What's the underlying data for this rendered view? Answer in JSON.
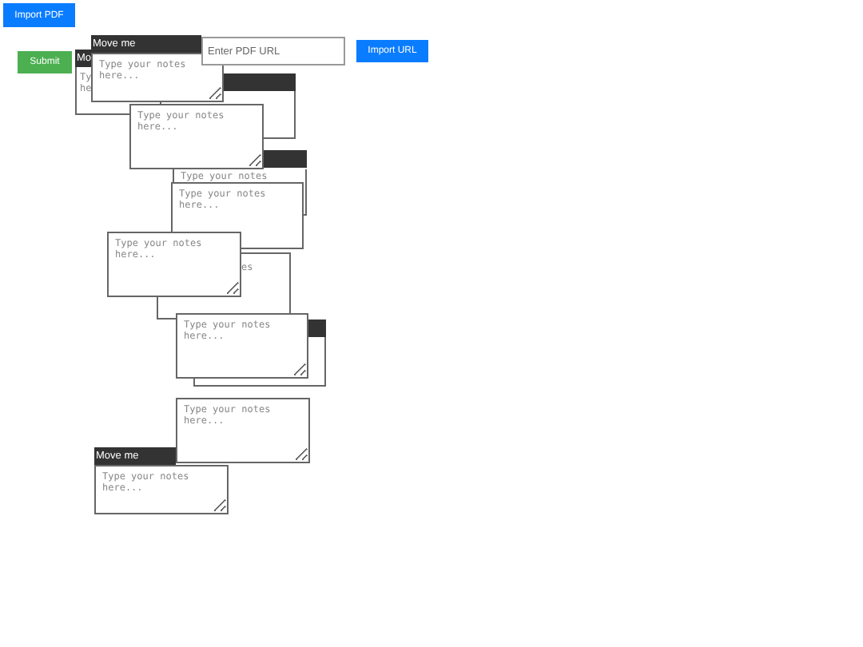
{
  "toolbar": {
    "import_pdf": "Import PDF",
    "submit": "Submit",
    "url_field": {
      "placeholder": "Enter PDF URL"
    },
    "import_url": "Import URL"
  },
  "notes": [
    {
      "kind": "partial",
      "header": "Mo",
      "placeholder": "Ty he"
    },
    {
      "kind": "partial"
    },
    {
      "kind": "open",
      "header": "Move me",
      "placeholder": "Type your notes here..."
    },
    {
      "kind": "partial",
      "placeholder": "Type your notes"
    },
    {
      "kind": "open",
      "placeholder": "Type your notes here..."
    },
    {
      "kind": "partial",
      "placeholder": "Type your notes here..."
    },
    {
      "kind": "partial",
      "placeholder": "es"
    },
    {
      "kind": "open",
      "placeholder": "Type your notes here..."
    },
    {
      "kind": "partial"
    },
    {
      "kind": "open",
      "placeholder": "Type your notes here..."
    },
    {
      "kind": "open",
      "header": "Move me",
      "placeholder": "Type your notes here..."
    },
    {
      "kind": "open",
      "placeholder": "Type your notes here..."
    }
  ]
}
